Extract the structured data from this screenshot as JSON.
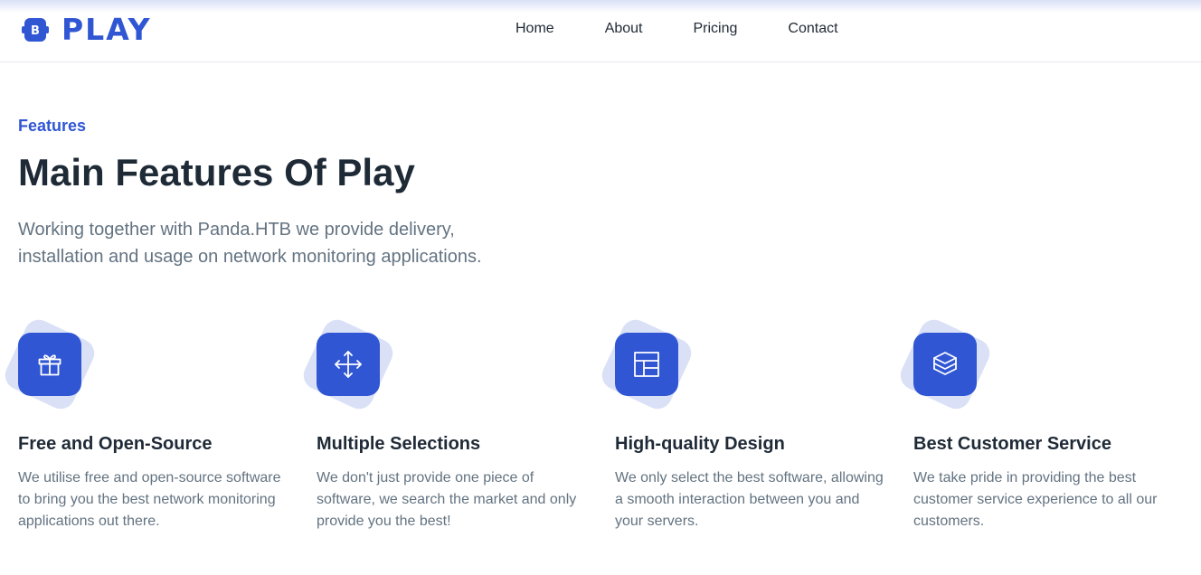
{
  "brand": {
    "name": "PLAY",
    "mark_letter": "B",
    "color": "#3056d3"
  },
  "nav": {
    "items": [
      "Home",
      "About",
      "Pricing",
      "Contact"
    ]
  },
  "section": {
    "eyebrow": "Features",
    "title": "Main Features Of Play",
    "lead": "Working together with Panda.HTB we provide delivery, installation and usage on network monitoring applications."
  },
  "features": [
    {
      "icon": "gift-icon",
      "title": "Free and Open-Source",
      "text": "We utilise free and open-source software to bring you the best network monitoring applications out there."
    },
    {
      "icon": "move-arrows-icon",
      "title": "Multiple Selections",
      "text": "We don't just provide one piece of software, we search the market and only provide you the best!"
    },
    {
      "icon": "layout-icon",
      "title": "High-quality Design",
      "text": "We only select the best software, allowing a smooth interaction between you and your servers."
    },
    {
      "icon": "layers-icon",
      "title": "Best Customer Service",
      "text": "We take pride in providing the best customer service experience to all our customers."
    }
  ]
}
